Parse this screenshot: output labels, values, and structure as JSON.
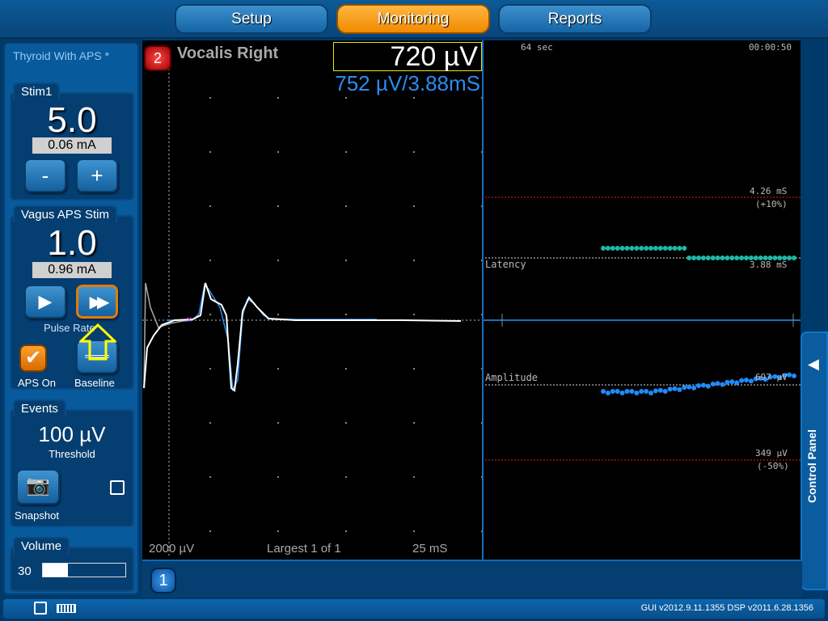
{
  "nav": {
    "tabs": [
      {
        "label": "Setup"
      },
      {
        "label": "Monitoring",
        "active": true
      },
      {
        "label": "Reports"
      }
    ]
  },
  "left": {
    "procedure": "Thyroid With APS *",
    "stim1": {
      "label": "Stim1",
      "value": "5.0",
      "current": "0.06 mA",
      "minus": "-",
      "plus": "+"
    },
    "vagus": {
      "label": "Vagus APS Stim",
      "value": "1.0",
      "current": "0.96 mA",
      "pulse_rate": "Pulse Rate",
      "aps_on": "APS On",
      "aps_on_checked": true,
      "baseline": "Baseline"
    },
    "events": {
      "label": "Events",
      "threshold_value": "100 µV",
      "threshold_label": "Threshold",
      "snapshot": "Snapshot"
    },
    "volume": {
      "label": "Volume",
      "value": "30",
      "level_percent": 30
    }
  },
  "waveform": {
    "channel_badge": "2",
    "channel_name": "Vocalis Right",
    "amplitude": "720 µV",
    "baseline": "752 µV/3.88mS",
    "scale": "2000 µV",
    "mode": "Largest 1 of 1",
    "timebase": "25 mS"
  },
  "trend": {
    "window": "64 sec",
    "elapsed": "00:00:50",
    "latency": {
      "label": "Latency",
      "upper_limit": "4.26 mS",
      "upper_pct": "(+10%)",
      "baseline": "3.88 mS"
    },
    "amplitude": {
      "label": "Amplitude",
      "baseline": "697 µV",
      "lower_limit": "349 µV",
      "lower_pct": "(-50%)"
    }
  },
  "control_panel": {
    "label": "Control Panel"
  },
  "bottom": {
    "channel_button": "1"
  },
  "status": {
    "versions": "GUI v2012.9.11.1355   DSP v2011.6.28.1356"
  },
  "colors": {
    "active_tab": "#f39a14",
    "latency_trend": "#1fb8a8",
    "amplitude_trend": "#1e8cff",
    "limit": "#e02020"
  }
}
